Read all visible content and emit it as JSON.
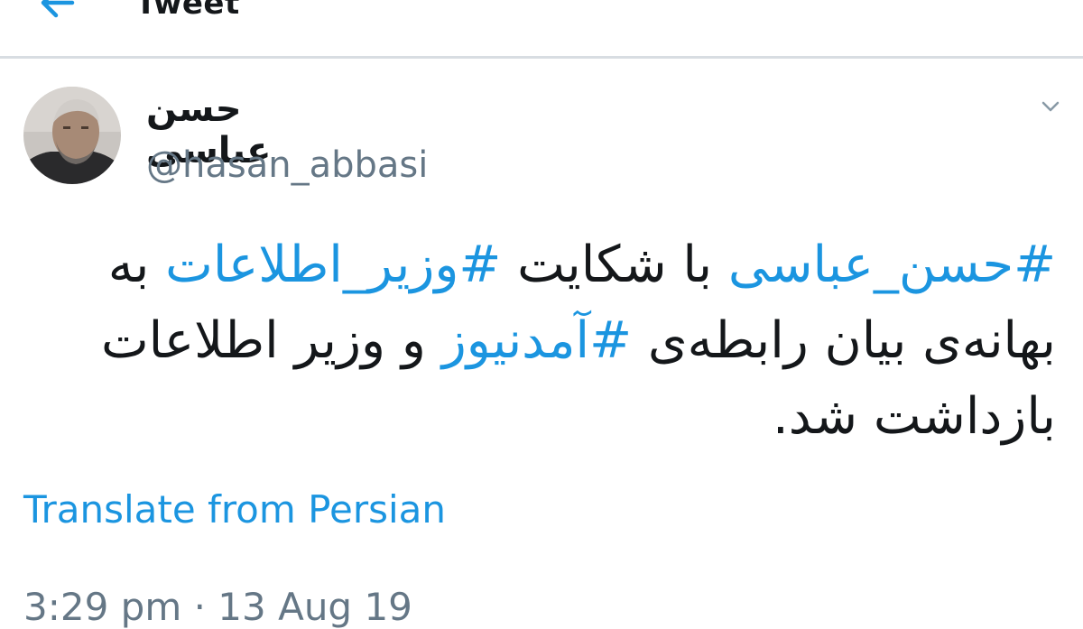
{
  "header": {
    "title": "Tweet",
    "back_icon": "arrow-left-icon"
  },
  "tweet": {
    "author": {
      "display_name": "حسن عباسی",
      "handle": "@hasan_abbasi",
      "avatar_icon": "profile-photo"
    },
    "menu_icon": "chevron-down-icon",
    "text_parts": [
      {
        "type": "hashtag",
        "text": "#حسن_عباسی"
      },
      {
        "type": "text",
        "text": " با شکایت "
      },
      {
        "type": "hashtag",
        "text": "#وزیر_اطلاعات"
      },
      {
        "type": "text",
        "text": " به بهانه‌ی بیان رابطه‌ی "
      },
      {
        "type": "hashtag",
        "text": "#آمدنیوز"
      },
      {
        "type": "text",
        "text": " و وزیر اطلاعات بازداشت شد."
      }
    ],
    "translate_label": "Translate from Persian",
    "timestamp": "3:29 pm · 13 Aug 19"
  },
  "colors": {
    "link": "#1b95e0",
    "text": "#14171a",
    "secondary": "#657786",
    "divider": "#d8dde2"
  }
}
